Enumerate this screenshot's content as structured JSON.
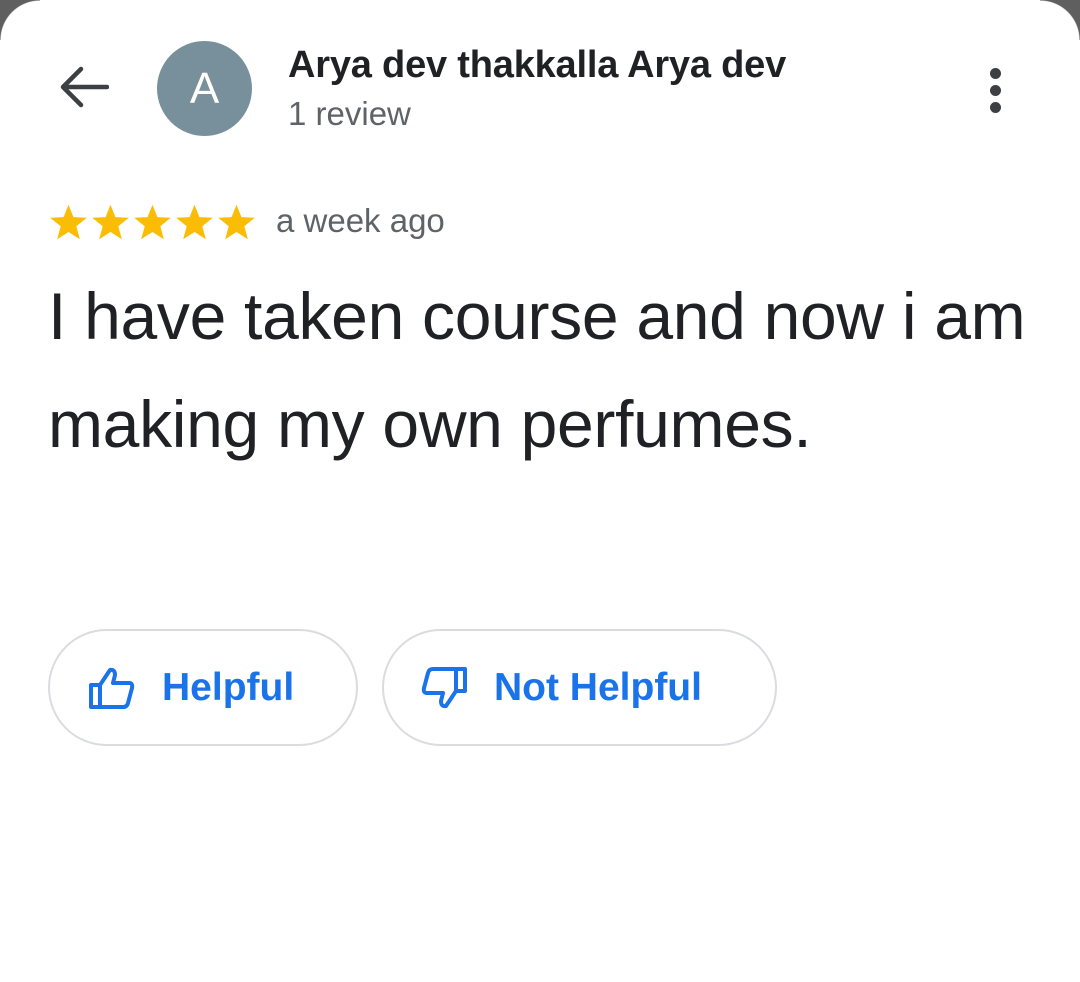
{
  "header": {
    "back_icon": "arrow-back-icon",
    "avatar_letter": "A",
    "avatar_color": "#78909c",
    "author_name": "Arya dev thakkalla Arya dev",
    "author_meta": "1 review",
    "more_icon": "more-vert-icon"
  },
  "review": {
    "rating": 5,
    "max_rating": 5,
    "star_color": "#fbbc04",
    "time_ago": "a week ago",
    "text": "I have taken course and now i am making my own perfumes."
  },
  "actions": {
    "accent_color": "#1a73e8",
    "helpful_label": "Helpful",
    "helpful_icon": "thumbs-up-icon",
    "not_helpful_label": "Not Helpful",
    "not_helpful_icon": "thumbs-down-icon"
  }
}
